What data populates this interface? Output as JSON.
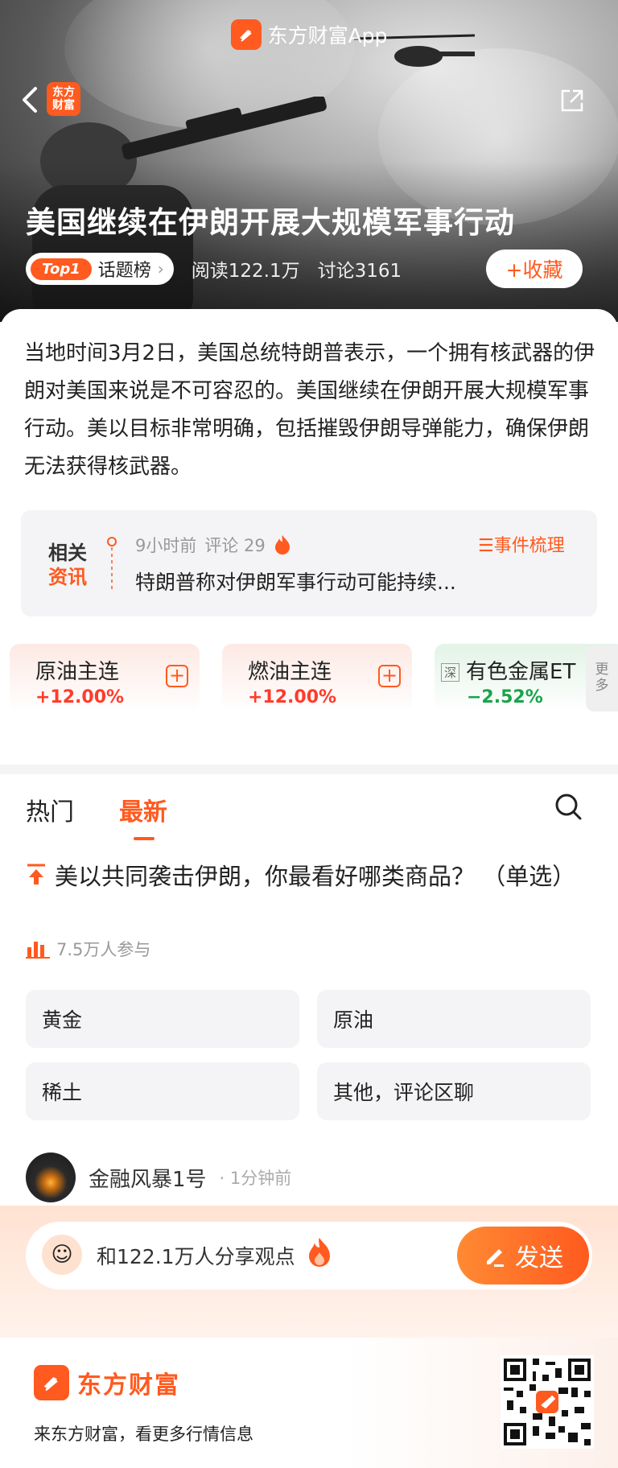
{
  "app_badge": {
    "name": "东方财富App",
    "icon": "eastmoney-logo-icon"
  },
  "header": {
    "brand_mini": "东方\n财富",
    "back_icon": "chevron-left-icon",
    "share_icon": "share-icon"
  },
  "hero": {
    "title": "美国继续在伊朗开展大规模军事行动",
    "topic_rank": "Top1",
    "topic_label": "话题榜",
    "reads": "阅读122.1万",
    "discussions": "讨论3161",
    "favorite_label": "+收藏"
  },
  "summary": "当地时间3月2日，美国总统特朗普表示，一个拥有核武器的伊朗对美国来说是不可容忍的。美国继续在伊朗开展大规模军事行动。美以目标非常明确，包括摧毁伊朗导弹能力，确保伊朗无法获得核武器。",
  "related": {
    "tag_line1": "相关",
    "tag_line2": "资讯",
    "time": "9小时前",
    "comments": "评论 29",
    "title": "特朗普称对伊朗军事行动可能持续...",
    "event_link": "☰事件梳理"
  },
  "sectors": [
    {
      "name": "原油主连",
      "change": "+12.00%",
      "trend": "up"
    },
    {
      "name": "燃油主连",
      "change": "+12.00%",
      "trend": "up"
    },
    {
      "name": "有色金属ET",
      "change": "−2.52%",
      "trend": "down",
      "market": "深"
    }
  ],
  "more_label": "更多",
  "feed": {
    "tabs": [
      "热门",
      "最新"
    ],
    "active_tab": "最新",
    "poll": {
      "question": "美以共同袭击伊朗，你最看好哪类商品？ （单选）",
      "participants": "7.5万人参与",
      "options": [
        "黄金",
        "原油",
        "稀土",
        "其他，评论区聊"
      ]
    },
    "post": {
      "author": "金融风暴1号",
      "time": "· 1分钟前"
    }
  },
  "comment_bar": {
    "placeholder": "和122.1万人分享观点",
    "send_label": "发送"
  },
  "footer": {
    "brand": "东方财富",
    "tagline": "来东方财富，看更多行情信息"
  },
  "colors": {
    "accent": "#ff5a1f",
    "up": "#ff3b2a",
    "down": "#1aa34a"
  }
}
